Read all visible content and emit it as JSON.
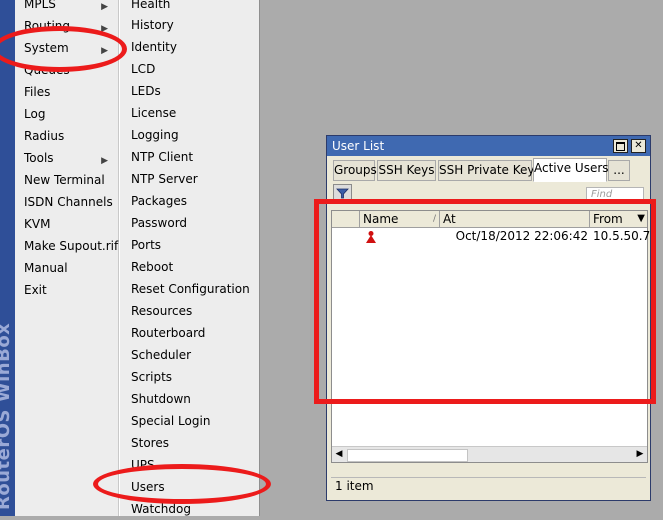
{
  "brand": {
    "text": "RouterOS WinBox"
  },
  "main_menu": [
    {
      "label": "MPLS",
      "submenu": true
    },
    {
      "label": "Routing",
      "submenu": true
    },
    {
      "label": "System",
      "submenu": true
    },
    {
      "label": "Queues",
      "submenu": false
    },
    {
      "label": "Files",
      "submenu": false
    },
    {
      "label": "Log",
      "submenu": false
    },
    {
      "label": "Radius",
      "submenu": false
    },
    {
      "label": "Tools",
      "submenu": true
    },
    {
      "label": "New Terminal",
      "submenu": false
    },
    {
      "label": "ISDN Channels",
      "submenu": false
    },
    {
      "label": "KVM",
      "submenu": false
    },
    {
      "label": "Make Supout.rif",
      "submenu": false
    },
    {
      "label": "Manual",
      "submenu": false
    },
    {
      "label": "Exit",
      "submenu": false
    }
  ],
  "system_menu": [
    "Health",
    "History",
    "Identity",
    "LCD",
    "LEDs",
    "License",
    "Logging",
    "NTP Client",
    "NTP Server",
    "Packages",
    "Password",
    "Ports",
    "Reboot",
    "Reset Configuration",
    "Resources",
    "Routerboard",
    "Scheduler",
    "Scripts",
    "Shutdown",
    "Special Login",
    "Stores",
    "UPS",
    "Users",
    "Watchdog"
  ],
  "window": {
    "title": "User List",
    "tabs": [
      "Groups",
      "SSH Keys",
      "SSH Private Keys",
      "Active Users",
      "..."
    ],
    "active_tab": "Active Users",
    "find_placeholder": "Find",
    "columns": {
      "name": "Name",
      "at": "At",
      "from": "From"
    },
    "rows": [
      {
        "name": "",
        "at": "Oct/18/2012 22:06:42",
        "from": "10.5.50.7"
      }
    ],
    "status": "1 item"
  },
  "colors": {
    "highlight": "#ec1b1b",
    "titlebar": "#3f69b1",
    "brand": "#2f4f98"
  },
  "icons": {
    "filter": "filter-icon",
    "user": "active-user-icon"
  }
}
